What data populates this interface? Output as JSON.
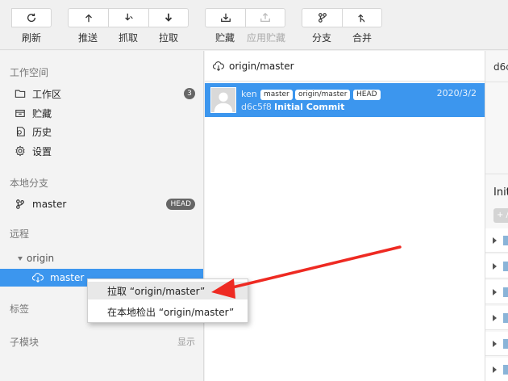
{
  "toolbar": {
    "refresh": "刷新",
    "push": "推送",
    "fetch": "抓取",
    "pull": "拉取",
    "stash": "贮藏",
    "apply_stash": "应用贮藏",
    "branch": "分支",
    "merge": "合并"
  },
  "sidebar": {
    "workspace_title": "工作空间",
    "workspace_items": [
      {
        "label": "工作区",
        "icon": "folder-icon",
        "badge": "3"
      },
      {
        "label": "贮藏",
        "icon": "stash-icon"
      },
      {
        "label": "历史",
        "icon": "history-icon"
      },
      {
        "label": "设置",
        "icon": "gear-icon"
      }
    ],
    "local_branches_title": "本地分支",
    "local_branch": {
      "label": "master",
      "badge": "HEAD"
    },
    "remote_title": "远程",
    "remote_name": "origin",
    "remote_branch": "master",
    "tags_title": "标签",
    "submodules_title": "子模块",
    "submodules_show": "显示"
  },
  "commits": {
    "header": "origin/master",
    "rows": [
      {
        "author": "ken",
        "tags": [
          "master",
          "origin/master",
          "HEAD"
        ],
        "date": "2020/3/2",
        "hash": "d6c5f8",
        "message": "Initial Commit"
      }
    ]
  },
  "detail": {
    "hash_trunc": "d6c",
    "title_trunc": "Init",
    "button_trunc": "+ /"
  },
  "context_menu": {
    "items": [
      "拉取 “origin/master”",
      "在本地检出 “origin/master”"
    ]
  },
  "colors": {
    "accent": "#3c96ee",
    "arrow": "#ee2a22"
  }
}
